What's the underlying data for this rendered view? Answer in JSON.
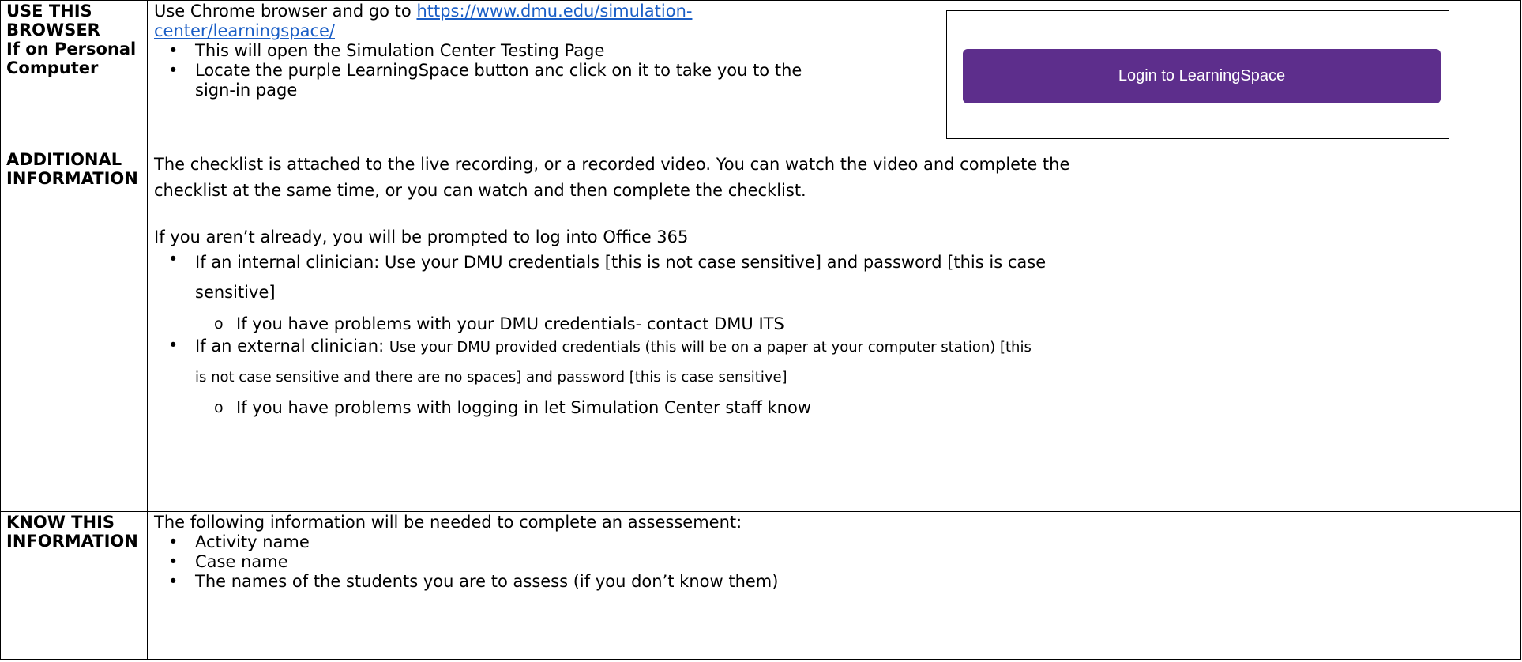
{
  "rows": [
    {
      "label_lines": [
        "USE THIS",
        "BROWSER",
        "If on Personal",
        "Computer"
      ],
      "intro": "Use Chrome browser and go to ",
      "link_line1": "https://www.dmu.edu/simulation-",
      "link_line2": "center/learningspace/",
      "bullets": [
        "This will open the Simulation Center Testing Page",
        "Locate the purple LearningSpace button anc click on it to take you to the",
        "sign-in page"
      ],
      "login_button_label": "Login to LearningSpace",
      "colors": {
        "login_button": "#5d2e8c",
        "link": "#1a5ec6"
      }
    },
    {
      "label_lines": [
        "ADDITIONAL",
        "INFORMATION"
      ],
      "paragraph_line1": "The checklist is attached to the live recording, or a recorded video. You can watch the video and complete the",
      "paragraph_line2": "checklist at the same time, or you can watch and then complete the checklist.",
      "office_line": "If you aren’t already, you will be prompted to log into Office 365",
      "internal_line1": "If an internal clinician: Use your DMU credentials [this is not case sensitive] and password [this is case",
      "internal_line2": "sensitive]",
      "internal_sub": "If you have problems with your DMU credentials- contact DMU ITS",
      "external_prefix": "If an external clinician: ",
      "external_line1": "Use your DMU provided credentials (this will be on a paper at your computer station) [this",
      "external_line2": "is not case sensitive and there are no spaces] and password [this is case sensitive]",
      "external_sub": "If you have problems with logging in let Simulation Center staff know"
    },
    {
      "label_lines": [
        "KNOW THIS",
        "INFORMATION"
      ],
      "intro": "The following information will be needed to complete an assessement:",
      "bullets": [
        "Activity name",
        "Case name",
        "The names of the students you are to assess (if you don’t know them)"
      ]
    }
  ]
}
